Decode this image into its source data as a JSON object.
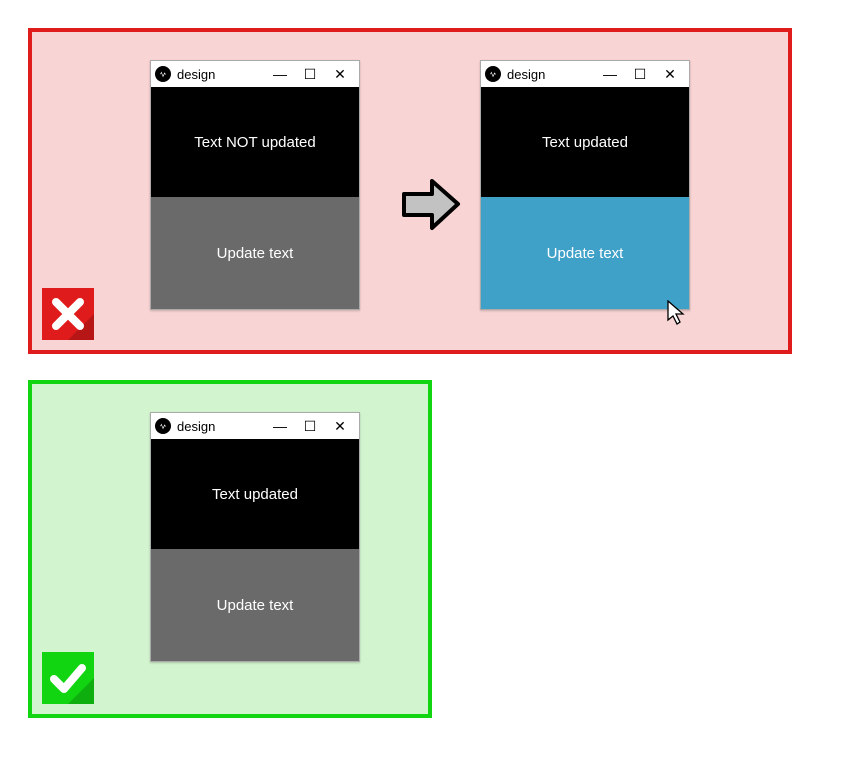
{
  "icons": {
    "app": "design-app-icon",
    "min": "—",
    "max": "☐",
    "close": "✕"
  },
  "red": {
    "badge": "wrong",
    "window1": {
      "title": "design",
      "text": "Text NOT updated",
      "button": "Update text"
    },
    "window2": {
      "title": "design",
      "text": "Text updated",
      "button": "Update text"
    }
  },
  "green": {
    "badge": "correct",
    "window": {
      "title": "design",
      "text": "Text updated",
      "button": "Update text"
    }
  }
}
